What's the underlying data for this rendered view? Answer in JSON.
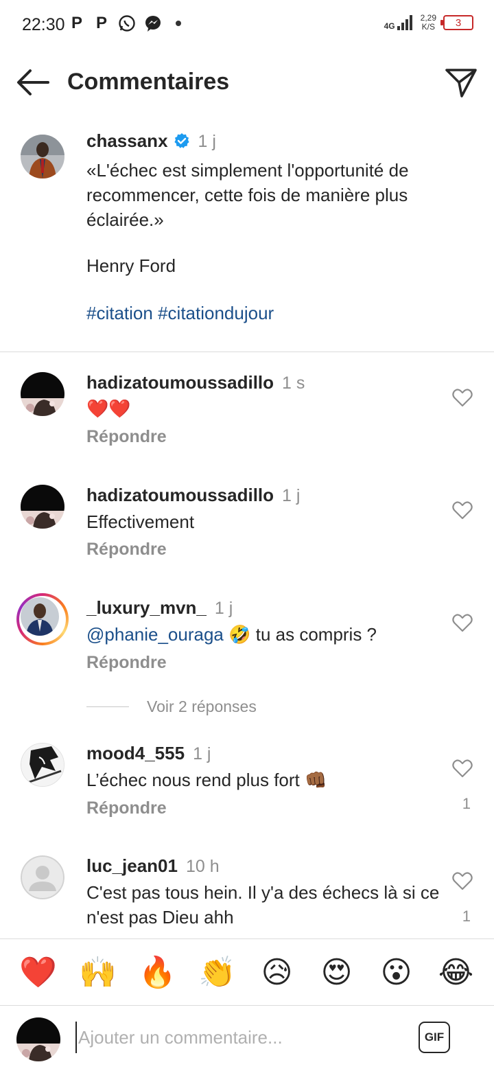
{
  "status_bar": {
    "time": "22:30",
    "network": "4G",
    "speed_value": "2,29",
    "speed_unit": "K/S",
    "battery": "3"
  },
  "header": {
    "title": "Commentaires"
  },
  "caption": {
    "username": "chassanx",
    "time": "1 j",
    "text": "«L'échec est simplement l'opportunité de recommencer, cette fois de manière plus éclairée.»",
    "author": "Henry Ford",
    "tags": [
      "#citation",
      "#citationdujour"
    ]
  },
  "comments": [
    {
      "username": "hadizatoumoussadillo",
      "time": "1 s",
      "text": "❤️❤️",
      "reply_label": "Répondre"
    },
    {
      "username": "hadizatoumoussadillo",
      "time": "1 j",
      "text": "Effectivement",
      "reply_label": "Répondre"
    },
    {
      "username": "_luxury_mvn_",
      "time": "1 j",
      "mention": "@phanie_ouraga",
      "emoji": "🤣",
      "text": "tu as compris ?",
      "reply_label": "Répondre"
    },
    {
      "username": "mood4_555",
      "time": "1 j",
      "text": "L’échec nous rend plus fort",
      "emoji": "👊🏾",
      "reply_label": "Répondre",
      "likes": "1"
    },
    {
      "username": "luc_jean01",
      "time": "10 h",
      "text": "C'est pas tous hein. Il y'a des échecs là si ce n'est pas Dieu ahh",
      "likes": "1"
    }
  ],
  "view_replies": "Voir 2 réponses",
  "reactions": [
    "❤️",
    "🙌",
    "🔥",
    "👏",
    "😥",
    "😍",
    "😮",
    "😂"
  ],
  "input": {
    "placeholder": "Ajouter un commentaire...",
    "gif_label": "GIF"
  }
}
